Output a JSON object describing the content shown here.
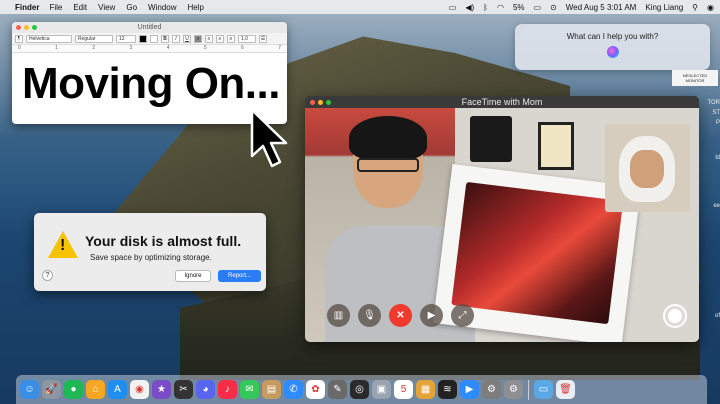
{
  "menubar": {
    "apple_icon": "apple-logo-icon",
    "app_name": "Finder",
    "menus": [
      "File",
      "Edit",
      "View",
      "Go",
      "Window",
      "Help"
    ],
    "battery": "5%",
    "datetime": "Wed Aug 5  3:01 AM",
    "user": "King Liang"
  },
  "textedit": {
    "title": "Untitled",
    "font_family": "Helvetica",
    "font_style": "Regular",
    "font_size": "12",
    "line_spacing": "1.0",
    "ruler_ticks": [
      "0",
      "1",
      "2",
      "3",
      "4",
      "5",
      "6",
      "7"
    ],
    "content": "Moving On..."
  },
  "siri": {
    "prompt": "What can I help you with?"
  },
  "desktop": {
    "sticker_label": "NEGLECTED MONITOR",
    "edge_texts": [
      "TOR",
      "ST",
      "P",
      "ld",
      "ee",
      "of"
    ]
  },
  "alert": {
    "title": "Your disk is almost full.",
    "message": "Save space by optimizing storage.",
    "help_label": "?",
    "ignore_label": "Ignore",
    "report_label": "Report..."
  },
  "facetime": {
    "title": "FaceTime with Mom",
    "controls": [
      "sidebar-icon",
      "mic-mute-icon",
      "end-call-icon",
      "camera-icon",
      "fullscreen-icon"
    ],
    "controls_glyphs": [
      "▥",
      "🎙",
      "✕",
      "▶",
      "⤢"
    ]
  },
  "dock": {
    "apps": [
      {
        "name": "finder-icon",
        "color": "#3a8ee6",
        "glyph": "☺"
      },
      {
        "name": "launchpad-icon",
        "color": "#8c96a3",
        "glyph": "🚀"
      },
      {
        "name": "chrome-like-icon",
        "color": "#1db954",
        "glyph": "●"
      },
      {
        "name": "home-icon",
        "color": "#f5a623",
        "glyph": "⌂"
      },
      {
        "name": "app-store-icon",
        "color": "#1f8ef1",
        "glyph": "A"
      },
      {
        "name": "chrome-icon",
        "color": "#f2f2f2",
        "glyph": "◉"
      },
      {
        "name": "imovie-icon",
        "color": "#7a4cc7",
        "glyph": "★"
      },
      {
        "name": "final-cut-icon",
        "color": "#333333",
        "glyph": "✂"
      },
      {
        "name": "discord-icon",
        "color": "#5865f2",
        "glyph": "◕"
      },
      {
        "name": "music-icon",
        "color": "#fa2d48",
        "glyph": "♪"
      },
      {
        "name": "messages-icon",
        "color": "#34c759",
        "glyph": "✉"
      },
      {
        "name": "notes-icon",
        "color": "#c59b5f",
        "glyph": "▤"
      },
      {
        "name": "messenger-icon",
        "color": "#2d8cff",
        "glyph": "✆"
      },
      {
        "name": "photos-icon",
        "color": "#ffffff",
        "glyph": "✿"
      },
      {
        "name": "script-editor-icon",
        "color": "#6a6a6a",
        "glyph": "✎"
      },
      {
        "name": "obs-icon",
        "color": "#2a2a2a",
        "glyph": "◎"
      },
      {
        "name": "preview-icon",
        "color": "#9aa4b0",
        "glyph": "▣"
      },
      {
        "name": "calendar-icon",
        "color": "#ffffff",
        "glyph": "5"
      },
      {
        "name": "finder-files-icon",
        "color": "#e3a33a",
        "glyph": "▦"
      },
      {
        "name": "activity-monitor-icon",
        "color": "#222222",
        "glyph": "≋"
      },
      {
        "name": "zoom-icon",
        "color": "#2d8cff",
        "glyph": "▶"
      },
      {
        "name": "utility-icon",
        "color": "#7d7d7d",
        "glyph": "⚙"
      },
      {
        "name": "system-preferences-icon",
        "color": "#8e8e93",
        "glyph": "⚙"
      }
    ],
    "trailing": [
      {
        "name": "downloads-folder-icon",
        "color": "#5aa9e6",
        "glyph": "▭"
      },
      {
        "name": "trash-icon",
        "color": "#e8eef3",
        "glyph": "🗑"
      }
    ]
  }
}
